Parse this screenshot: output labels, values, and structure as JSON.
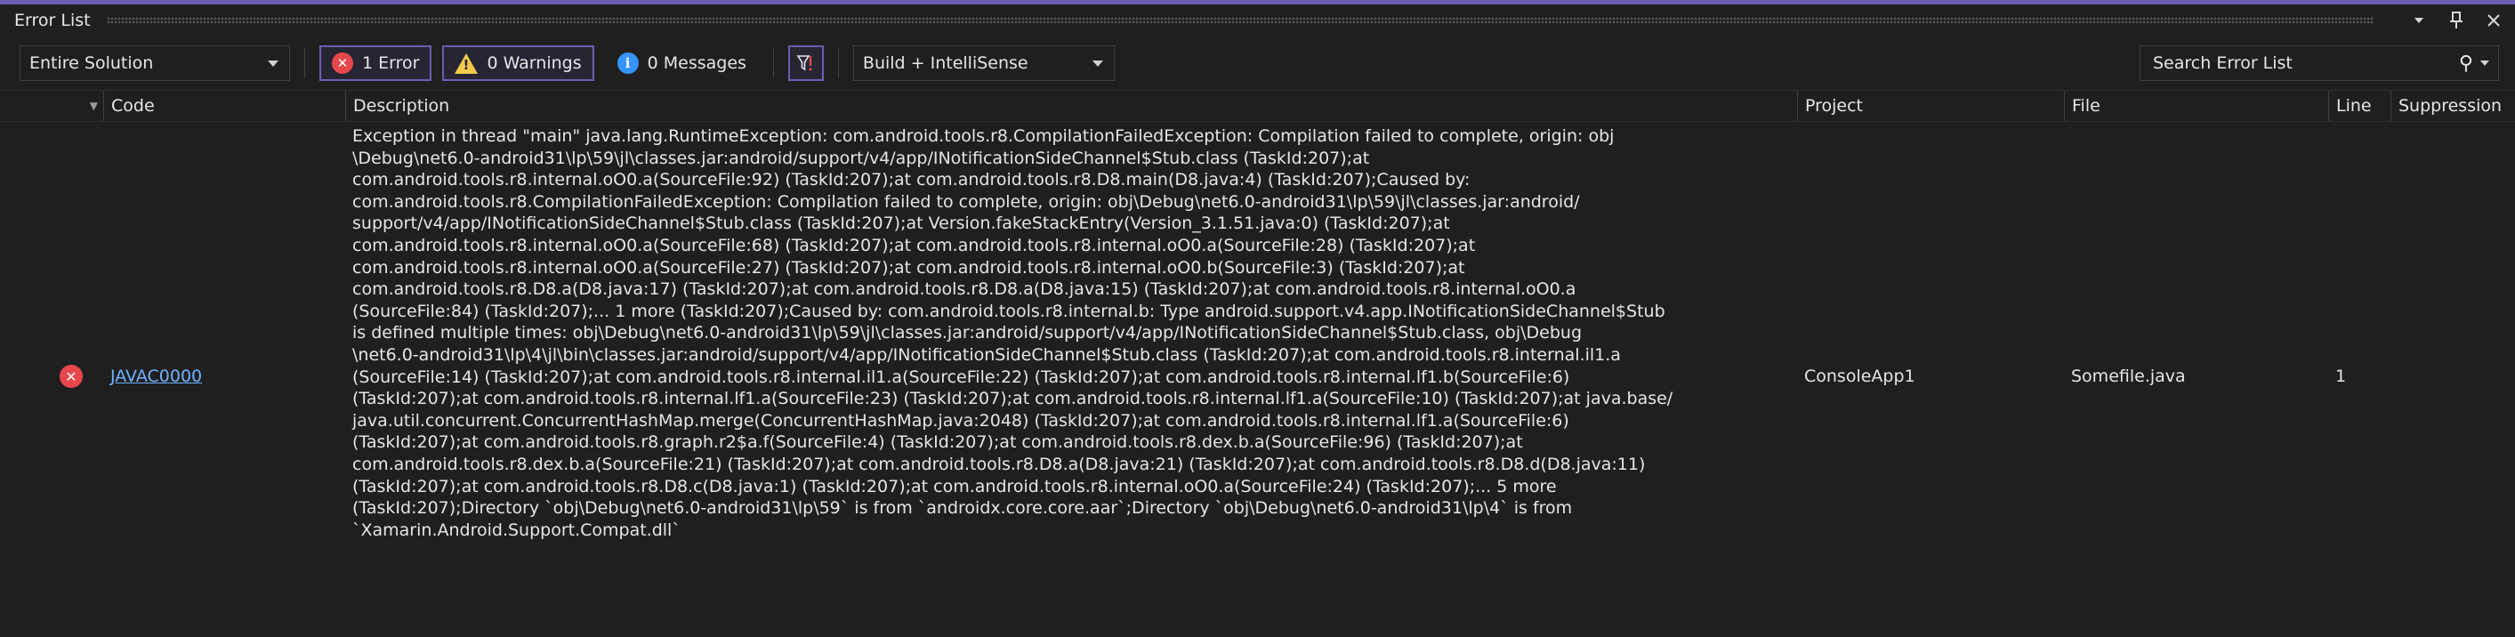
{
  "window": {
    "title": "Error List",
    "controls": [
      "dropdown-arrow",
      "pin",
      "close"
    ]
  },
  "toolbar": {
    "scope": "Entire Solution",
    "errors_label": "1 Error",
    "warnings_label": "0 Warnings",
    "messages_label": "0 Messages",
    "build_filter": "Build + IntelliSense",
    "search_placeholder": "Search Error List"
  },
  "columns": {
    "code": "Code",
    "description": "Description",
    "project": "Project",
    "file": "File",
    "line": "Line",
    "suppression": "Suppression"
  },
  "rows": [
    {
      "severity": "error",
      "code": "JAVAC0000",
      "description": "Exception in thread \"main\" java.lang.RuntimeException: com.android.tools.r8.CompilationFailedException: Compilation failed to complete, origin: obj\n\\Debug\\net6.0-android31\\lp\\59\\jl\\classes.jar:android/support/v4/app/INotificationSideChannel$Stub.class (TaskId:207);at\ncom.android.tools.r8.internal.oO0.a(SourceFile:92) (TaskId:207);at com.android.tools.r8.D8.main(D8.java:4) (TaskId:207);Caused by:\ncom.android.tools.r8.CompilationFailedException: Compilation failed to complete, origin: obj\\Debug\\net6.0-android31\\lp\\59\\jl\\classes.jar:android/\nsupport/v4/app/INotificationSideChannel$Stub.class (TaskId:207);at Version.fakeStackEntry(Version_3.1.51.java:0) (TaskId:207);at\ncom.android.tools.r8.internal.oO0.a(SourceFile:68) (TaskId:207);at com.android.tools.r8.internal.oO0.a(SourceFile:28) (TaskId:207);at\ncom.android.tools.r8.internal.oO0.a(SourceFile:27) (TaskId:207);at com.android.tools.r8.internal.oO0.b(SourceFile:3) (TaskId:207);at\ncom.android.tools.r8.D8.a(D8.java:17) (TaskId:207);at com.android.tools.r8.D8.a(D8.java:15) (TaskId:207);at com.android.tools.r8.internal.oO0.a\n(SourceFile:84) (TaskId:207);... 1 more (TaskId:207);Caused by: com.android.tools.r8.internal.b: Type android.support.v4.app.INotificationSideChannel$Stub\nis defined multiple times: obj\\Debug\\net6.0-android31\\lp\\59\\jl\\classes.jar:android/support/v4/app/INotificationSideChannel$Stub.class, obj\\Debug\n\\net6.0-android31\\lp\\4\\jl\\bin\\classes.jar:android/support/v4/app/INotificationSideChannel$Stub.class (TaskId:207);at com.android.tools.r8.internal.il1.a\n(SourceFile:14) (TaskId:207);at com.android.tools.r8.internal.il1.a(SourceFile:22) (TaskId:207);at com.android.tools.r8.internal.lf1.b(SourceFile:6)\n(TaskId:207);at com.android.tools.r8.internal.lf1.a(SourceFile:23) (TaskId:207);at com.android.tools.r8.internal.lf1.a(SourceFile:10) (TaskId:207);at java.base/\njava.util.concurrent.ConcurrentHashMap.merge(ConcurrentHashMap.java:2048) (TaskId:207);at com.android.tools.r8.internal.lf1.a(SourceFile:6)\n(TaskId:207);at com.android.tools.r8.graph.r2$a.f(SourceFile:4) (TaskId:207);at com.android.tools.r8.dex.b.a(SourceFile:96) (TaskId:207);at\ncom.android.tools.r8.dex.b.a(SourceFile:21) (TaskId:207);at com.android.tools.r8.D8.a(D8.java:21) (TaskId:207);at com.android.tools.r8.D8.d(D8.java:11)\n(TaskId:207);at com.android.tools.r8.D8.c(D8.java:1) (TaskId:207);at com.android.tools.r8.internal.oO0.a(SourceFile:24) (TaskId:207);... 5 more\n(TaskId:207);Directory `obj\\Debug\\net6.0-android31\\lp\\59` is from `androidx.core.core.aar`;Directory `obj\\Debug\\net6.0-android31\\lp\\4` is from\n`Xamarin.Android.Support.Compat.dll`",
      "project": "ConsoleApp1",
      "file": "Somefile.java",
      "line": "1",
      "suppression": ""
    }
  ],
  "colors": {
    "accent": "#6b5fb3",
    "error": "#e8474c",
    "warning": "#f2c94c",
    "info": "#3794ff",
    "link": "#71b3ff"
  }
}
